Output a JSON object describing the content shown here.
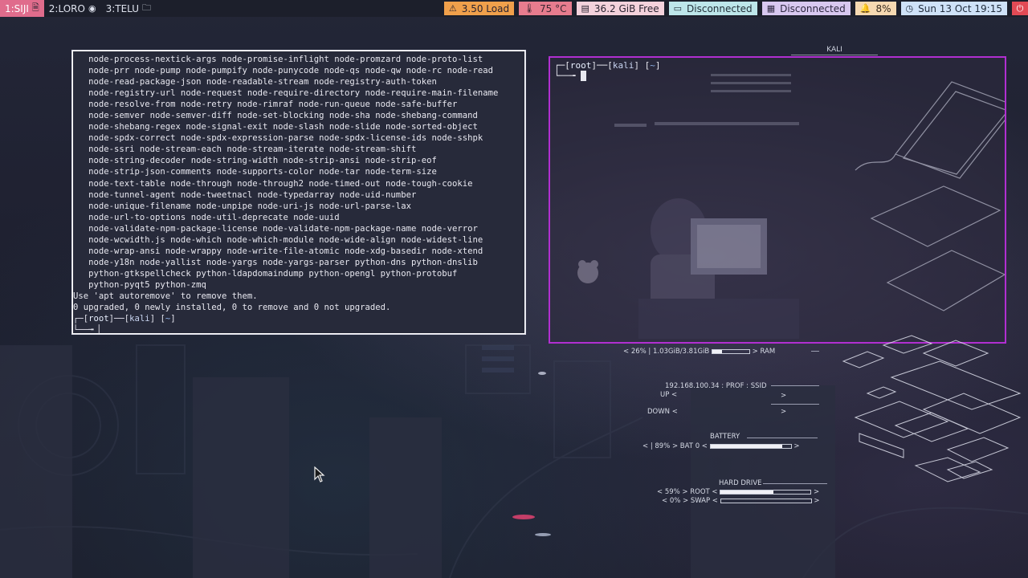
{
  "topbar": {
    "workspaces": [
      {
        "id": "ws1",
        "label": "1:SIJI",
        "icon": "document-icon",
        "active": true
      },
      {
        "id": "ws2",
        "label": "2:LORO",
        "icon": "firefox-icon",
        "active": false
      },
      {
        "id": "ws3",
        "label": "3:TELU",
        "icon": "folder-icon",
        "active": false
      }
    ],
    "modules": {
      "load": "3.50 Load",
      "temp": "75 °C",
      "disk": "36.2 GiB Free",
      "net1": "Disconnected",
      "net2": "Disconnected",
      "battery": "8%",
      "datetime": "Sun 13 Oct 19:15"
    }
  },
  "terminal_left": {
    "lines": [
      "   node-process-nextick-args node-promise-inflight node-promzard node-proto-list",
      "   node-prr node-pump node-pumpify node-punycode node-qs node-qw node-rc node-read",
      "   node-read-package-json node-readable-stream node-registry-auth-token",
      "   node-registry-url node-request node-require-directory node-require-main-filename",
      "   node-resolve-from node-retry node-rimraf node-run-queue node-safe-buffer",
      "   node-semver node-semver-diff node-set-blocking node-sha node-shebang-command",
      "   node-shebang-regex node-signal-exit node-slash node-slide node-sorted-object",
      "   node-spdx-correct node-spdx-expression-parse node-spdx-license-ids node-sshpk",
      "   node-ssri node-stream-each node-stream-iterate node-stream-shift",
      "   node-string-decoder node-string-width node-strip-ansi node-strip-eof",
      "   node-strip-json-comments node-supports-color node-tar node-term-size",
      "   node-text-table node-through node-through2 node-timed-out node-tough-cookie",
      "   node-tunnel-agent node-tweetnacl node-typedarray node-uid-number",
      "   node-unique-filename node-unpipe node-uri-js node-url-parse-lax",
      "   node-url-to-options node-util-deprecate node-uuid",
      "   node-validate-npm-package-license node-validate-npm-package-name node-verror",
      "   node-wcwidth.js node-which node-which-module node-wide-align node-widest-line",
      "   node-wrap-ansi node-wrappy node-write-file-atomic node-xdg-basedir node-xtend",
      "   node-y18n node-yallist node-yargs node-yargs-parser python-dns python-dnslib",
      "   python-gtkspellcheck python-ldapdomaindump python-opengl python-protobuf",
      "   python-pyqt5 python-zmq",
      "Use 'apt autoremove' to remove them.",
      "0 upgraded, 0 newly installed, 0 to remove and 0 not upgraded."
    ],
    "prompt_user": "root",
    "prompt_host": "kali",
    "prompt_dir": "~"
  },
  "terminal_right": {
    "prompt_user": "root",
    "prompt_host": "kali",
    "prompt_dir": "~"
  },
  "conky": {
    "kali_label": "KALI",
    "ram": "< 26% | 1.03GiB/3.81GiB",
    "ram_label": "> RAM",
    "ram_fraction": 0.26,
    "net_info": "192.168.100.34 : PROF : SSID",
    "up": "UP <",
    "down": "DOWN <",
    "battery_title": "BATTERY",
    "battery": "< | 89% > BAT 0 <",
    "battery_fraction": 0.89,
    "hdd_title": "HARD DRIVE",
    "root": "< 59% > ROOT <",
    "root_fraction": 0.59,
    "swap": "< 0% > SWAP <",
    "swap_fraction": 0.0,
    "gt": ">",
    "gt2": ">"
  }
}
